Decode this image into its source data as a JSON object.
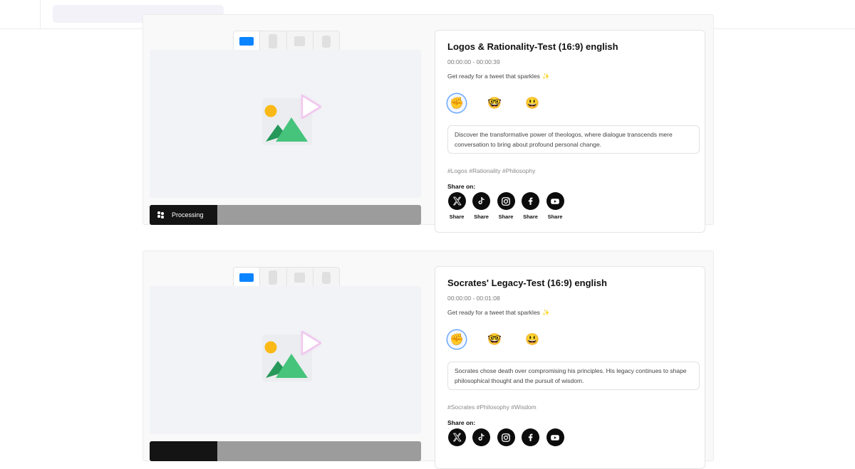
{
  "header": {
    "search_placeholder": ""
  },
  "items": [
    {
      "title": "Logos & Rationality-Test (16:9) english",
      "time_range": "00:00:00 - 00:00:39",
      "tagline": "Get ready for a tweet that sparkles",
      "description": "Discover the transformative power of theologos, where dialogue transcends mere conversation to bring about profound personal change.",
      "hashtags": "#Logos #Rationality #Philosophy",
      "status_label": "Processing",
      "share_on_label": "Share on:",
      "emojis": [
        "✊",
        "🤓",
        "😃"
      ]
    },
    {
      "title": "Socrates' Legacy-Test (16:9) english",
      "time_range": "00:00:00 - 00:01:08",
      "tagline": "Get ready for a tweet that sparkles",
      "description": "Socrates chose death over compromising his principles. His legacy continues to shape philosophical thought and the pursuit of wisdom.",
      "hashtags": "#Socrates #Philosophy #Wisdom",
      "status_label": "",
      "share_on_label": "Share on:",
      "emojis": [
        "✊",
        "🤓",
        "😃"
      ]
    }
  ],
  "aspect_ratios": [
    "landscape-icon",
    "portrait-icon",
    "square-icon",
    "vertical-icon"
  ],
  "socials": [
    {
      "name": "x-icon",
      "label": "Share"
    },
    {
      "name": "tiktok-icon",
      "label": "Share"
    },
    {
      "name": "instagram-icon",
      "label": "Share"
    },
    {
      "name": "facebook-icon",
      "label": "Share"
    },
    {
      "name": "youtube-icon",
      "label": "Share"
    }
  ],
  "colors": {
    "accent": "#0a84ff",
    "progress_track": "#9c9c9c",
    "progress_fill": "#141414"
  }
}
